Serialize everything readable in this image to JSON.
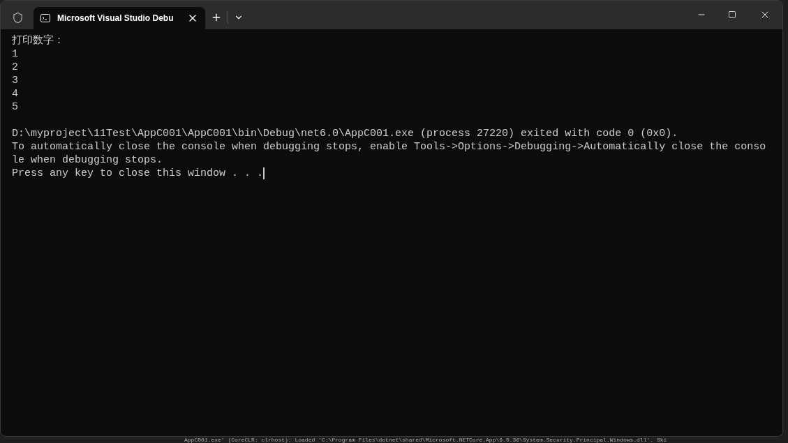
{
  "window": {
    "tab_title": "Microsoft Visual Studio Debu"
  },
  "console": {
    "blocks": [
      [
        "打印数字：",
        "1",
        "2",
        "3",
        "4",
        "5"
      ],
      [
        "D:\\myproject\\11Test\\AppC001\\AppC001\\bin\\Debug\\net6.0\\AppC001.exe (process 27220) exited with code 0 (0x0).",
        "To automatically close the console when debugging stops, enable Tools->Options->Debugging->Automatically close the conso",
        "le when debugging stops.",
        "Press any key to close this window . . ."
      ]
    ],
    "cursor": true
  },
  "background_output": "AppC001.exe' (CoreCLR: clrhost): Loaded 'C:\\Program Files\\dotnet\\shared\\Microsoft.NETCore.App\\6.0.36\\System.Security.Principal.Windows.dll'. Ski"
}
